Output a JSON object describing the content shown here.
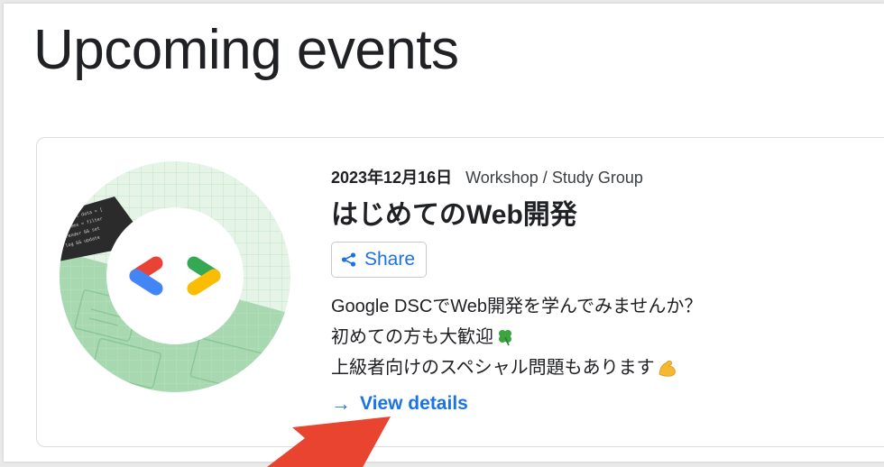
{
  "page": {
    "heading": "Upcoming events"
  },
  "event": {
    "date": "2023年12月16日",
    "category": "Workshop / Study Group",
    "title": "はじめてのWeb開発",
    "share_label": "Share",
    "description": [
      "Google DSCでWeb開発を学んでみませんか？",
      "初めての方も大歓迎",
      "上級者向けのスペシャル問題もあります"
    ],
    "details_arrow": "→",
    "details_label": "View details"
  },
  "icons": {
    "share": "share-icon",
    "clover": "four-leaf-clover-icon",
    "flexed_biceps": "flexed-biceps-icon",
    "logo": "google-developers-logo",
    "pointer": "red-arrow-pointer"
  },
  "colors": {
    "link": "#1a73e8",
    "text": "#202124",
    "logo_red": "#ea4335",
    "logo_blue": "#4285f4",
    "logo_green": "#34a853",
    "logo_yellow": "#fbbc04",
    "pointer": "#e8442f"
  }
}
